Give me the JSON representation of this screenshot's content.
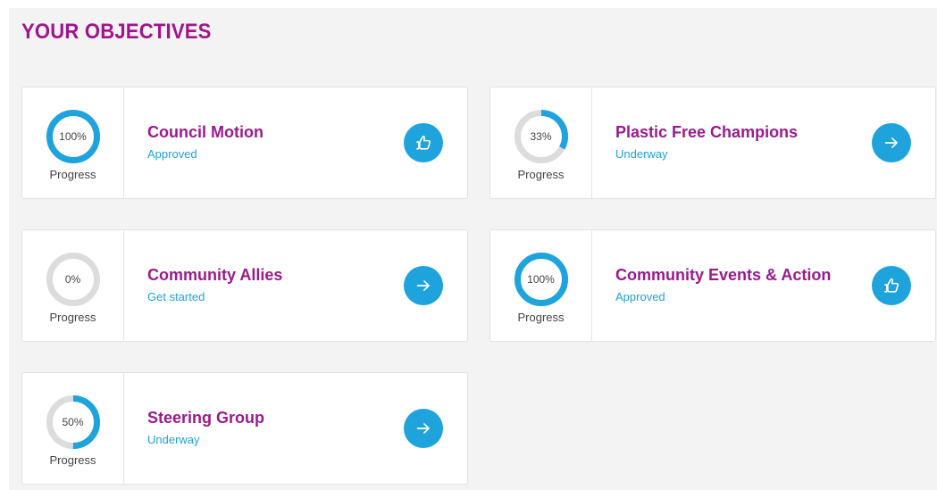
{
  "page": {
    "title": "YOUR OBJECTIVES"
  },
  "colors": {
    "accent_purple": "#9a1a8e",
    "accent_blue": "#1ea3dc",
    "ring_track": "#dcdcdc"
  },
  "objectives": [
    {
      "title": "Council Motion",
      "status": "Approved",
      "progress": 100,
      "progress_text": "100%",
      "progress_label": "Progress",
      "action_icon": "thumbs-up-icon"
    },
    {
      "title": "Plastic Free Champions",
      "status": "Underway",
      "progress": 33,
      "progress_text": "33%",
      "progress_label": "Progress",
      "action_icon": "arrow-right-icon"
    },
    {
      "title": "Community Allies",
      "status": "Get started",
      "progress": 0,
      "progress_text": "0%",
      "progress_label": "Progress",
      "action_icon": "arrow-right-icon"
    },
    {
      "title": "Community Events & Action",
      "status": "Approved",
      "progress": 100,
      "progress_text": "100%",
      "progress_label": "Progress",
      "action_icon": "thumbs-up-icon"
    },
    {
      "title": "Steering Group",
      "status": "Underway",
      "progress": 50,
      "progress_text": "50%",
      "progress_label": "Progress",
      "action_icon": "arrow-right-icon"
    }
  ]
}
